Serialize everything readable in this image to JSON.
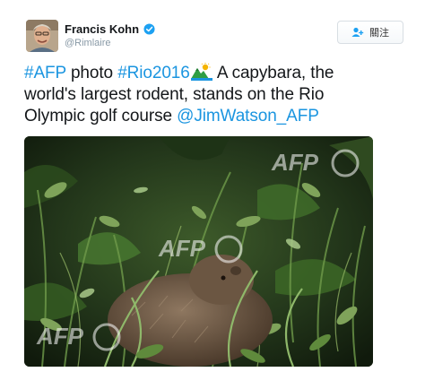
{
  "author": {
    "display_name": "Francis Kohn",
    "handle": "@Rimlaire",
    "verified": true
  },
  "follow_button": {
    "label": "關注",
    "icon": "follow-person-plus-icon"
  },
  "tweet": {
    "text_segments": [
      {
        "text": "#AFP",
        "type": "hashtag"
      },
      {
        "text": " photo ",
        "type": "text"
      },
      {
        "text": "#Rio2016",
        "type": "hashtag"
      },
      {
        "text": " A capybara, the",
        "type": "text"
      },
      {
        "text": "world's largest rodent, stands on the Rio",
        "type": "text"
      },
      {
        "text": "Olympic golf course ",
        "type": "text"
      },
      {
        "text": "@JimWatson_AFP",
        "type": "mention"
      }
    ],
    "emoji": "rio-mountain-sun-emoji-icon"
  },
  "media": {
    "watermark": "AFP"
  },
  "colors": {
    "link": "#1b95e0",
    "verified": "#1da1f2",
    "handle": "#8899a6"
  }
}
